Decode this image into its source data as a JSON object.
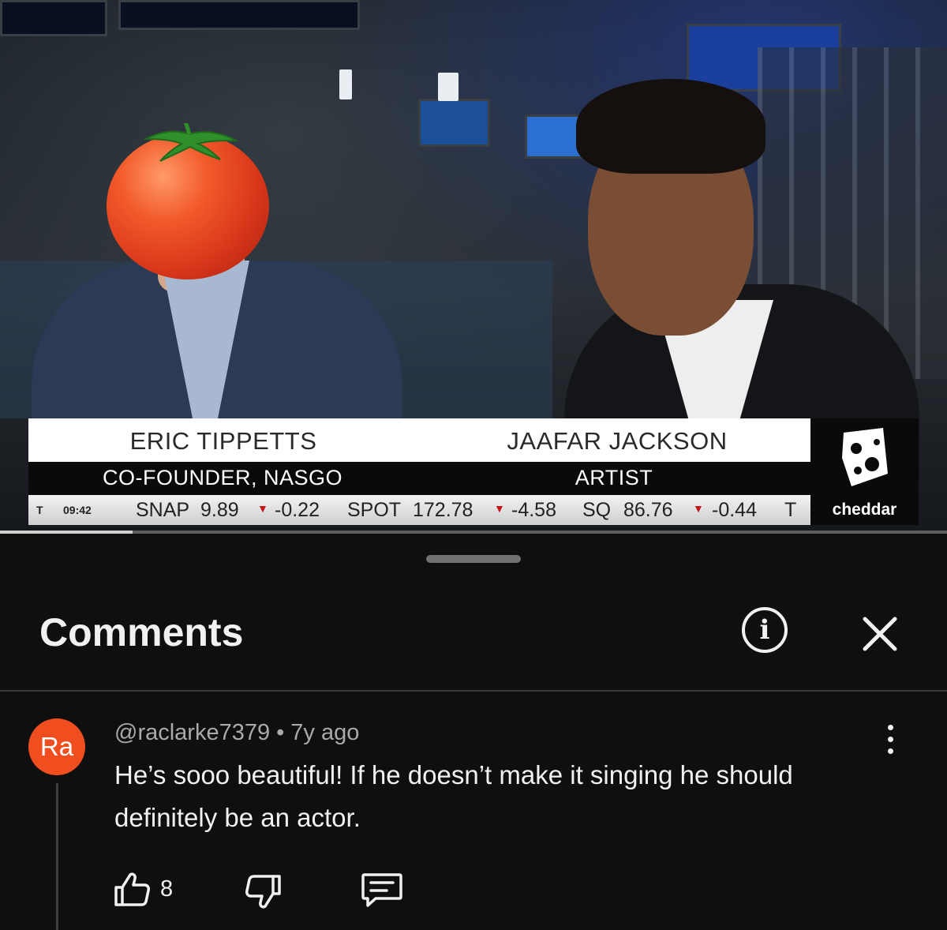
{
  "video": {
    "lower_third": {
      "guest_left": {
        "name": "ERIC TIPPETTS",
        "role": "CO-FOUNDER, NASGO"
      },
      "guest_right": {
        "name": "JAAFAR JACKSON",
        "role": "ARTIST"
      }
    },
    "ticker": {
      "prefix": "T",
      "time": "09:42",
      "items": [
        {
          "symbol": "SNAP",
          "price": "9.89",
          "change": "-0.22"
        },
        {
          "symbol": "SPOT",
          "price": "172.78",
          "change": "-4.58"
        },
        {
          "symbol": "SQ",
          "price": "86.76",
          "change": "-0.44"
        }
      ],
      "suffix": "T"
    },
    "channel_logo": "cheddar",
    "progress_fraction": 0.14,
    "overlay_emoji": "tomato"
  },
  "comments_panel": {
    "title": "Comments",
    "info_icon": "info-icon",
    "close_icon": "close-icon",
    "comments": [
      {
        "avatar_initials": "Ra",
        "avatar_color": "#f04e1e",
        "author": "@raclarke7379",
        "age": "7y ago",
        "text": "He’s sooo beautiful! If he doesn’t make it singing he should definitely be an actor.",
        "likes": "8"
      }
    ]
  }
}
